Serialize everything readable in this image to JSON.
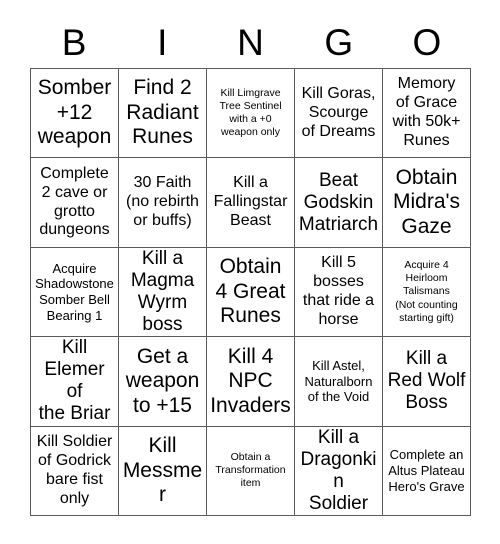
{
  "card": {
    "title_letters": [
      "B",
      "I",
      "N",
      "G",
      "O"
    ],
    "columns": 5,
    "rows": 5,
    "colors": {
      "background": "#ffffff",
      "text": "#000000",
      "grid_line": "#5a5a5a"
    },
    "cells": [
      {
        "row": 1,
        "col": 1,
        "column_letter": "B",
        "text": "Somber\n+12\nweapon",
        "size": "xl"
      },
      {
        "row": 1,
        "col": 2,
        "column_letter": "I",
        "text": "Find 2\nRadiant\nRunes",
        "size": "xl"
      },
      {
        "row": 1,
        "col": 3,
        "column_letter": "N",
        "text": "Kill Limgrave Tree Sentinel with a +0 weapon only",
        "size": "xs"
      },
      {
        "row": 1,
        "col": 4,
        "column_letter": "G",
        "text": "Kill Goras,\nScourge\nof Dreams",
        "size": "md"
      },
      {
        "row": 1,
        "col": 5,
        "column_letter": "O",
        "text": "Memory\nof Grace\nwith 50k+\nRunes",
        "size": "md"
      },
      {
        "row": 2,
        "col": 1,
        "column_letter": "B",
        "text": "Complete\n2 cave or\ngrotto\ndungeons",
        "size": "md"
      },
      {
        "row": 2,
        "col": 2,
        "column_letter": "I",
        "text": "30 Faith\n(no rebirth\nor buffs)",
        "size": "md"
      },
      {
        "row": 2,
        "col": 3,
        "column_letter": "N",
        "text": "Kill a\nFallingstar\nBeast",
        "size": "md"
      },
      {
        "row": 2,
        "col": 4,
        "column_letter": "G",
        "text": "Beat\nGodskin\nMatriarch",
        "size": "lg"
      },
      {
        "row": 2,
        "col": 5,
        "column_letter": "O",
        "text": "Obtain\nMidra's\nGaze",
        "size": "xl"
      },
      {
        "row": 3,
        "col": 1,
        "column_letter": "B",
        "text": "Acquire\nShadowstone\nSomber Bell\nBearing 1",
        "size": "sm"
      },
      {
        "row": 3,
        "col": 2,
        "column_letter": "I",
        "text": "Kill a\nMagma\nWyrm\nboss",
        "size": "lg"
      },
      {
        "row": 3,
        "col": 3,
        "column_letter": "N",
        "text": "Obtain\n4 Great\nRunes",
        "size": "xl"
      },
      {
        "row": 3,
        "col": 4,
        "column_letter": "G",
        "text": "Kill 5\nbosses\nthat ride a\nhorse",
        "size": "md"
      },
      {
        "row": 3,
        "col": 5,
        "column_letter": "O",
        "text": "Acquire 4\nHeirloom\nTalismans\n(Not counting\nstarting gift)",
        "size": "xs"
      },
      {
        "row": 4,
        "col": 1,
        "column_letter": "B",
        "text": "Kill\nElemer of\nthe Briar",
        "size": "lg"
      },
      {
        "row": 4,
        "col": 2,
        "column_letter": "I",
        "text": "Get a\nweapon\nto +15",
        "size": "xl"
      },
      {
        "row": 4,
        "col": 3,
        "column_letter": "N",
        "text": "Kill 4\nNPC\nInvaders",
        "size": "xl"
      },
      {
        "row": 4,
        "col": 4,
        "column_letter": "G",
        "text": "Kill Astel,\nNaturalborn\nof the Void",
        "size": "sm"
      },
      {
        "row": 4,
        "col": 5,
        "column_letter": "O",
        "text": "Kill a\nRed Wolf\nBoss",
        "size": "lg"
      },
      {
        "row": 5,
        "col": 1,
        "column_letter": "B",
        "text": "Kill Soldier\nof Godrick\nbare fist\nonly",
        "size": "md"
      },
      {
        "row": 5,
        "col": 2,
        "column_letter": "I",
        "text": "Kill\nMessmer",
        "size": "xl"
      },
      {
        "row": 5,
        "col": 3,
        "column_letter": "N",
        "text": "Obtain a\nTransformation\nitem",
        "size": "xs"
      },
      {
        "row": 5,
        "col": 4,
        "column_letter": "G",
        "text": "Kill a\nDragonkin\nSoldier",
        "size": "lg"
      },
      {
        "row": 5,
        "col": 5,
        "column_letter": "O",
        "text": "Complete an\nAltus Plateau\nHero's Grave",
        "size": "sm"
      }
    ]
  }
}
